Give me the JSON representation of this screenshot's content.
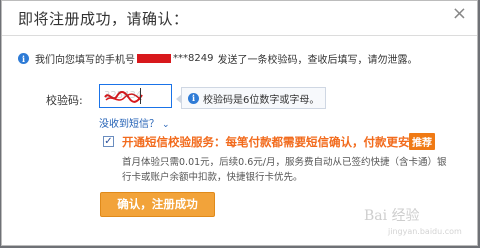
{
  "dialog": {
    "title": "即将注册成功，请确认：",
    "close_symbol": "×"
  },
  "info": {
    "icon": "info-icon",
    "prefix": "我们向您填写的手机号",
    "phone_suffix": "***8249",
    "suffix": "发送了一条校验码，查收后填写，请勿泄露。"
  },
  "code": {
    "label": "校验码:",
    "value": "325434",
    "tip": "校验码是6位数字或字母。"
  },
  "not_received": {
    "label": "没收到短信？",
    "chevron": "⌄"
  },
  "service": {
    "checked": true,
    "text": "开通短信校验服务：每笔付款都需要短信确认，付款更安全。",
    "badge": "推荐",
    "description": "首月体验只需0.01元，后续0.6元/月，服务费自动从已签约快捷（含卡通）银行卡或账户余额中扣款，快捷银行卡优先。"
  },
  "confirm_button": {
    "label": "确认，注册成功"
  },
  "watermark": {
    "text": "Bai 经验",
    "url": "jingyan.baidu.com"
  },
  "colors": {
    "accent_orange": "#f26b1d",
    "button_orange": "#f2a33a",
    "link_blue": "#2462b6",
    "info_blue": "#2e7bd6",
    "redaction_red": "#d8181c"
  }
}
